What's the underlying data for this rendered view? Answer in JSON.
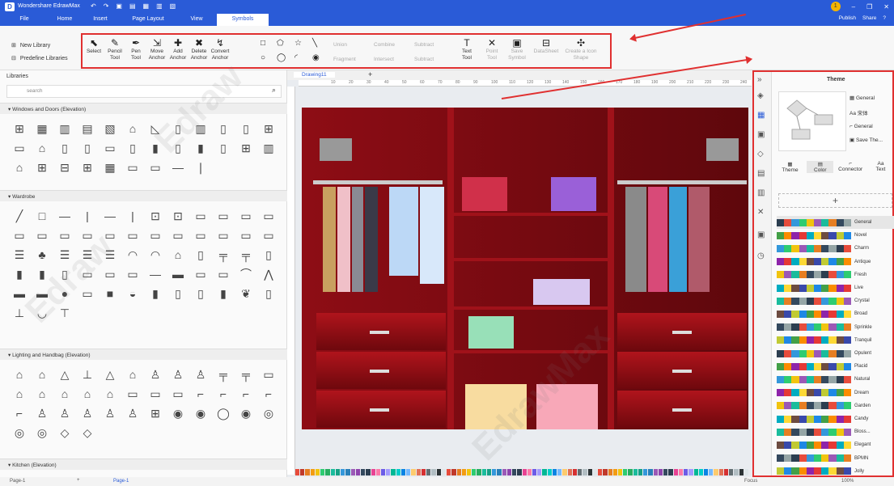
{
  "app": {
    "title": "Wondershare EdrawMax",
    "menu": [
      "File",
      "Home",
      "Insert",
      "Page Layout",
      "View",
      "Symbols"
    ],
    "active_menu": "Symbols",
    "publish": "Publish",
    "share": "Share",
    "avatar": "1"
  },
  "ribbon": {
    "new_library": "New Library",
    "predefine_libraries": "Predefine Libraries",
    "tools": [
      {
        "icon": "select-icon",
        "label": "Select",
        "glyph": "⬉"
      },
      {
        "icon": "pencil-icon",
        "label": "Pencil Tool",
        "glyph": "✎"
      },
      {
        "icon": "pen-icon",
        "label": "Pen Tool",
        "glyph": "✒"
      },
      {
        "icon": "move-anchor-icon",
        "label": "Move Anchor",
        "glyph": "⇲"
      },
      {
        "icon": "add-anchor-icon",
        "label": "Add Anchor",
        "glyph": "✚"
      },
      {
        "icon": "delete-anchor-icon",
        "label": "Delete Anchor",
        "glyph": "✖"
      },
      {
        "icon": "convert-anchor-icon",
        "label": "Convert Anchor",
        "glyph": "↯"
      }
    ],
    "shape_ops": [
      "Union",
      "Combine",
      "Subtract",
      "Fragment",
      "Intersect",
      "Subtract"
    ],
    "right_tools": [
      "Text Tool",
      "Point Tool",
      "Save Symbol",
      "DataSheet",
      "Create a Icon Shape"
    ]
  },
  "libraries": {
    "title": "Libraries",
    "search_placeholder": "search",
    "sections": [
      "Windows and Doors (Elevation)",
      "Wardrobe",
      "Lighting and Handbag (Elevation)",
      "Kitchen (Elevation)"
    ]
  },
  "canvas": {
    "tab": "Drawing11",
    "ruler_ticks": [
      "10",
      "20",
      "30",
      "40",
      "50",
      "60",
      "70",
      "80",
      "90",
      "100",
      "110",
      "120",
      "130",
      "140",
      "150",
      "160",
      "170",
      "180",
      "190",
      "200",
      "210",
      "220",
      "230",
      "240",
      "250"
    ]
  },
  "theme_panel": {
    "title": "Theme",
    "options": [
      "General",
      "宋体",
      "General",
      "Save The..."
    ],
    "tabs": [
      "Theme",
      "Color",
      "Connector",
      "Text"
    ],
    "selected_tab": "Color",
    "add_label": "+",
    "themes": [
      "General",
      "Novel",
      "Charm",
      "Antique",
      "Fresh",
      "Live",
      "Crystal",
      "Broad",
      "Sprinkle",
      "Tranquil",
      "Opulent",
      "Placid",
      "Natural",
      "Dream",
      "Garden",
      "Candy",
      "Bloss...",
      "Elegant",
      "BPMN",
      "Jolly"
    ]
  },
  "status": {
    "page": "Page-1",
    "tab": "Page-1",
    "focus": "Focus",
    "zoom": "100%"
  },
  "colors": {
    "accent": "#2a5bd7",
    "highlight": "#e03030",
    "wardrobe": "#7a0a10"
  }
}
